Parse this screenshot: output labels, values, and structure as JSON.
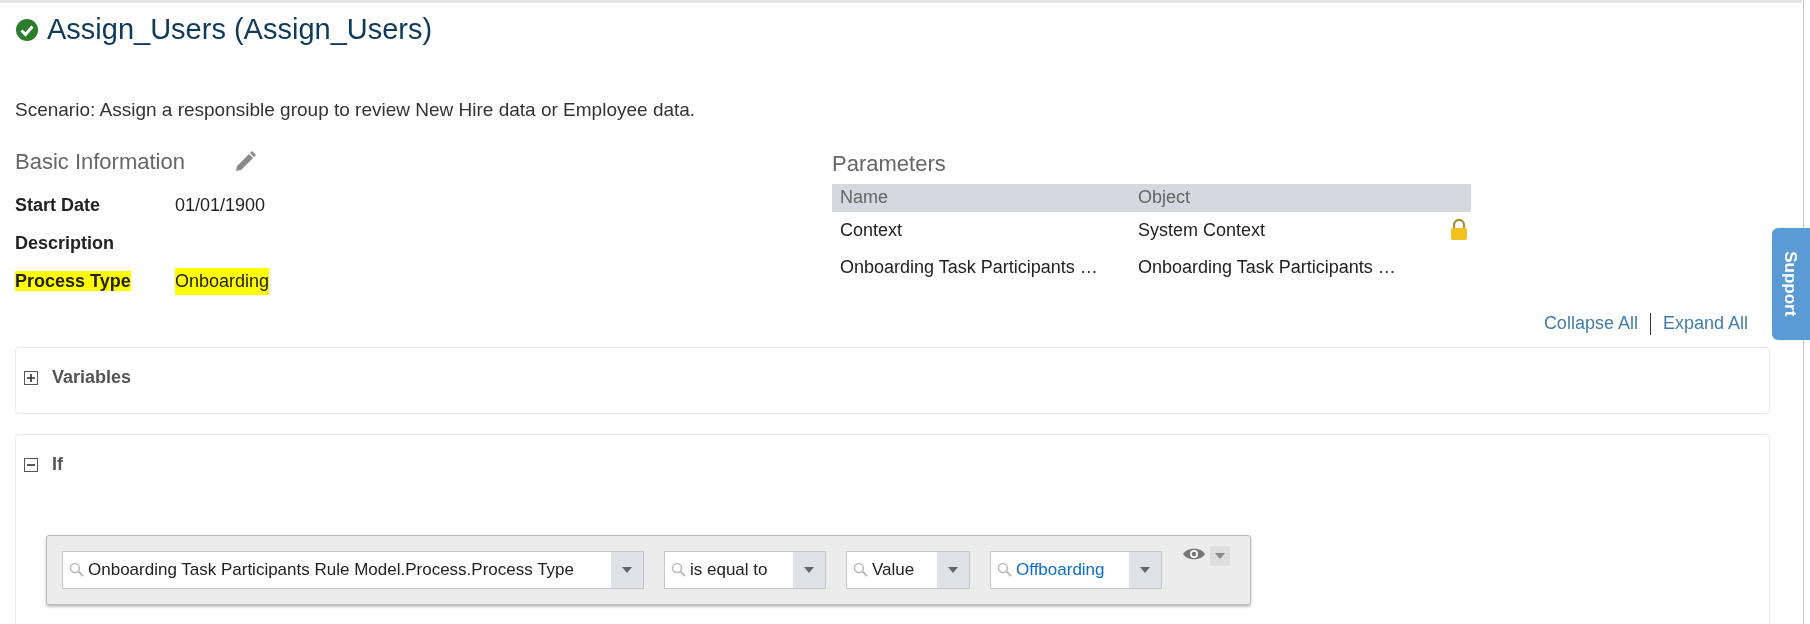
{
  "header": {
    "title": "Assign_Users (Assign_Users)",
    "valid": true
  },
  "scenario": "Scenario: Assign a responsible group to review New Hire data or Employee data.",
  "basic_information": {
    "heading": "Basic Information",
    "fields": [
      {
        "label": "Start Date",
        "value": "01/01/1900",
        "highlighted": false
      },
      {
        "label": "Description",
        "highlighted": false
      },
      {
        "label": "Process Type",
        "value": "Onboarding",
        "highlighted": true
      }
    ]
  },
  "parameters": {
    "heading": "Parameters",
    "columns": [
      "Name",
      "Object"
    ],
    "rows": [
      {
        "name": "Context",
        "object": "System Context",
        "locked": true
      },
      {
        "name": "Onboarding Task Participants …",
        "object": "Onboarding Task Participants …",
        "locked": false
      }
    ]
  },
  "links": [
    "Collapse All",
    "Expand All"
  ],
  "sections": [
    {
      "title": "Variables",
      "expanded": false
    },
    {
      "title": "If",
      "expanded": true
    }
  ],
  "condition": {
    "fields": [
      {
        "value": "Onboarding Task Participants Rule Model.Process.Process Type",
        "kind": "plain"
      },
      {
        "value": "is equal to",
        "kind": "plain"
      },
      {
        "value": "Value",
        "kind": "plain"
      },
      {
        "value": "Offboarding",
        "kind": "link"
      }
    ]
  },
  "support_tab": "Support"
}
